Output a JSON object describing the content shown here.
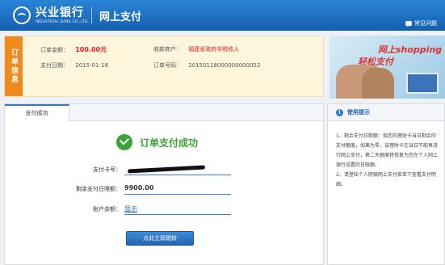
{
  "header": {
    "bank_name_cn": "兴业银行",
    "bank_name_en": "INDUSTRIAL BANK CO.,LTD.",
    "title": "网上支付",
    "faq_label": "常见问题"
  },
  "order": {
    "tag": "订单信息",
    "amount_label": "订单金额：",
    "amount": "100.00元",
    "merchant_label": "收款商户：",
    "merchant": "福建省政府非税收入",
    "date_label": "支付日期：",
    "date": "2015-01-18",
    "order_no_label": "订单号码：",
    "order_no": "20150118000000000052"
  },
  "banner": {
    "line1": "网上shopping",
    "line2": "轻松支付"
  },
  "main": {
    "tab": "支付成功",
    "success_text": "订单支付成功",
    "card_label": "支付卡号：",
    "limit_label": "剩余支付日限额：",
    "limit_value": "9900.00",
    "balance_label": "账户余额：",
    "balance_link": "显示",
    "redirect_button": "点此立即跳转"
  },
  "help": {
    "title": "使用提示",
    "item1": "1、剩余支付日限额：指您的理财卡当日剩余的支付额度，如果为零，该理财卡在当日不能再进行网上支付，第二天额度将恢复为您在个人网上银行设置的日限额。",
    "item2": "2、请登陆个人网银网上支付菜单下查看支付明细。"
  },
  "colors": {
    "header_blue": "#1a6fc0",
    "order_tag": "#f08a1f",
    "success_green": "#3aa335",
    "amount_red": "#e02020",
    "button_blue": "#2b78c8"
  }
}
